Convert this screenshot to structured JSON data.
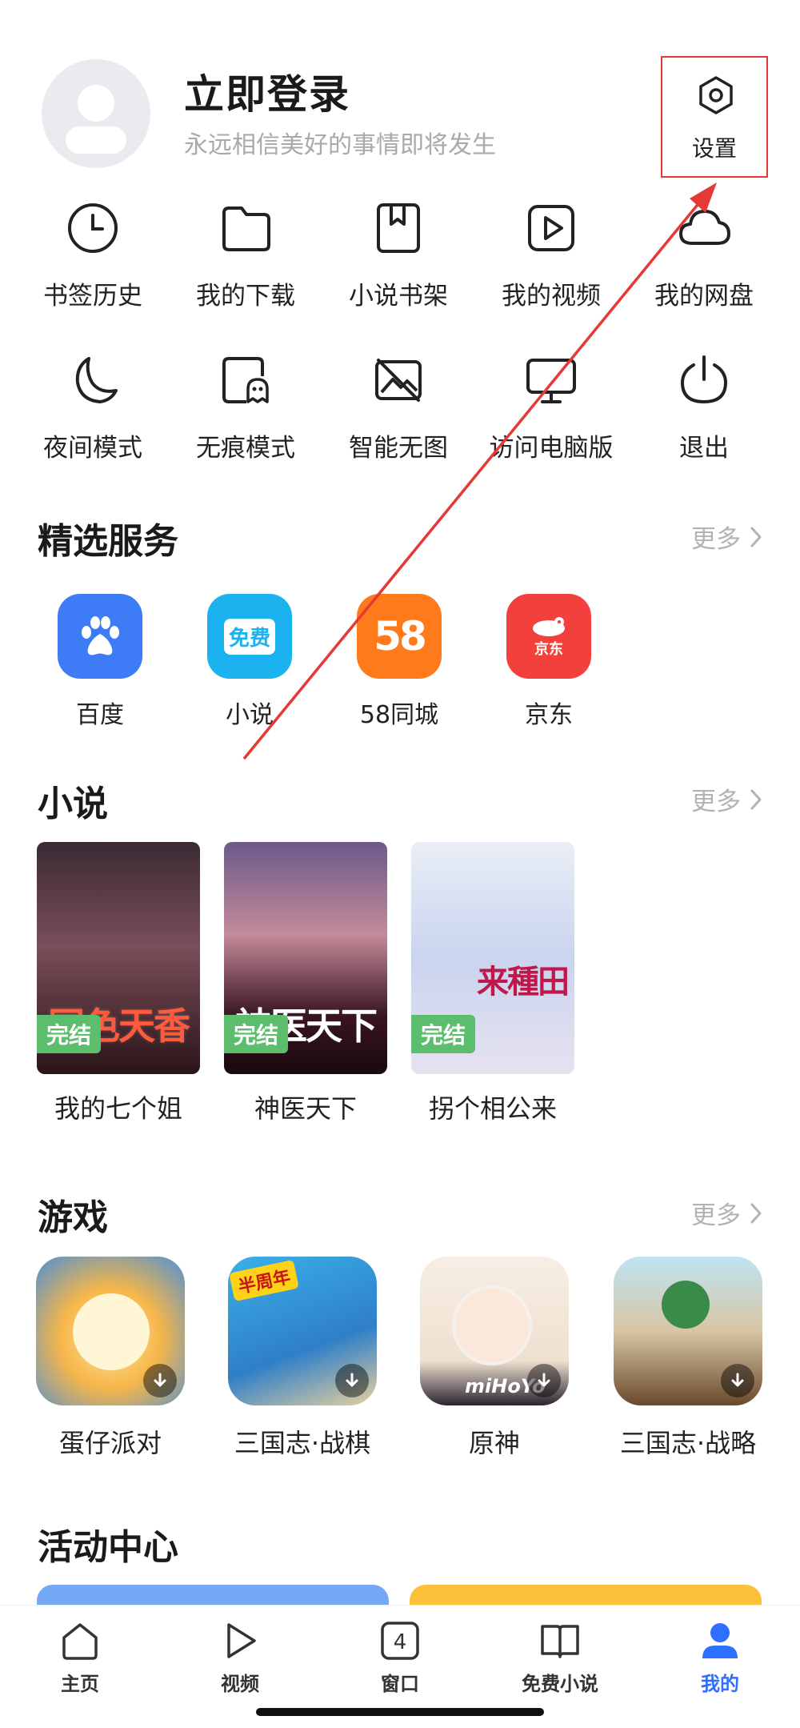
{
  "header": {
    "login_title": "立即登录",
    "login_subtitle": "永远相信美好的事情即将发生",
    "settings_label": "设置"
  },
  "quick_actions": [
    {
      "label": "书签历史",
      "icon": "clock-icon"
    },
    {
      "label": "我的下载",
      "icon": "folder-icon"
    },
    {
      "label": "小说书架",
      "icon": "bookmark-book-icon"
    },
    {
      "label": "我的视频",
      "icon": "play-video-icon"
    },
    {
      "label": "我的网盘",
      "icon": "cloud-icon"
    },
    {
      "label": "夜间模式",
      "icon": "moon-icon"
    },
    {
      "label": "无痕模式",
      "icon": "ghost-icon"
    },
    {
      "label": "智能无图",
      "icon": "no-image-icon"
    },
    {
      "label": "访问电脑版",
      "icon": "desktop-icon"
    },
    {
      "label": "退出",
      "icon": "power-icon"
    }
  ],
  "services": {
    "title": "精选服务",
    "more": "更多",
    "items": [
      {
        "label": "百度",
        "icon": "baidu-paw-icon",
        "color": "#3d7cf6"
      },
      {
        "label": "小说",
        "icon": "free-novel-icon",
        "color": "#1ab2ef",
        "tile_text": "免费"
      },
      {
        "label": "58同城",
        "icon": "58-icon",
        "color": "#ff7a1a",
        "tile_text": "58"
      },
      {
        "label": "京东",
        "icon": "jd-dog-icon",
        "color": "#f2413d",
        "tile_text": "京东"
      }
    ]
  },
  "novels": {
    "title": "小说",
    "more": "更多",
    "items": [
      {
        "label": "我的七个姐",
        "badge": "完结",
        "cover_text": "国色天香"
      },
      {
        "label": "神医天下",
        "badge": "完结",
        "cover_text": "神医天下"
      },
      {
        "label": "拐个相公来",
        "badge": "完结",
        "cover_text": "来種田"
      }
    ]
  },
  "games": {
    "title": "游戏",
    "more": "更多",
    "items": [
      {
        "label": "蛋仔派对"
      },
      {
        "label": "三国志·战棋",
        "tag": "半周年"
      },
      {
        "label": "原神",
        "tag": "miHoYo"
      },
      {
        "label": "三国志·战略"
      }
    ]
  },
  "activity": {
    "title": "活动中心"
  },
  "bottom_nav": [
    {
      "label": "主页",
      "icon": "home-icon"
    },
    {
      "label": "视频",
      "icon": "play-icon"
    },
    {
      "label": "窗口",
      "icon": "tabs-count-icon",
      "count": "4"
    },
    {
      "label": "免费小说",
      "icon": "open-book-icon"
    },
    {
      "label": "我的",
      "icon": "user-icon",
      "active": true
    }
  ],
  "colors": {
    "accent": "#2f6fff",
    "annotation": "#e53935",
    "badge_green": "#5cbd6c"
  }
}
